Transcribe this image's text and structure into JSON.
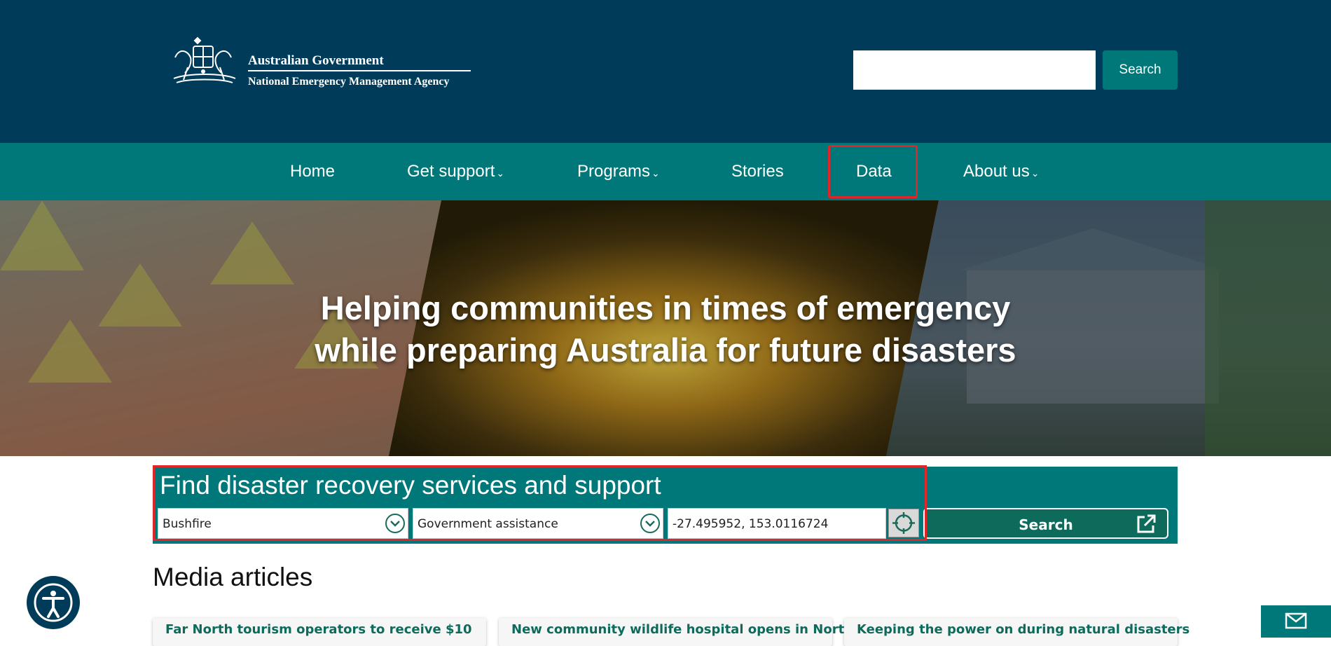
{
  "header": {
    "logo_line1": "Australian Government",
    "logo_line2": "National Emergency Management Agency",
    "search_placeholder": "",
    "search_button": "Search"
  },
  "nav": {
    "items": [
      {
        "label": "Home",
        "has_menu": false
      },
      {
        "label": "Get support",
        "has_menu": true
      },
      {
        "label": "Programs",
        "has_menu": true
      },
      {
        "label": "Stories",
        "has_menu": false
      },
      {
        "label": "Data",
        "has_menu": false
      },
      {
        "label": "About us",
        "has_menu": true
      }
    ],
    "dropdown_glyph": "⌄"
  },
  "hero": {
    "title_line1": "Helping communities in times of emergency",
    "title_line2": "while preparing Australia for future disasters"
  },
  "finder": {
    "title": "Find disaster recovery services and support",
    "disaster_type": "Bushfire",
    "assistance_type": "Government assistance",
    "location": "-27.495952, 153.0116724",
    "search_button": "Search"
  },
  "media": {
    "heading": "Media articles",
    "articles": [
      "Far North tourism operators to receive $10",
      "New community wildlife hospital opens in North",
      "Keeping the power on during natural disasters"
    ]
  },
  "colors": {
    "header_bg": "#003c5a",
    "accent": "#00787a",
    "highlight": "#e0262b"
  }
}
